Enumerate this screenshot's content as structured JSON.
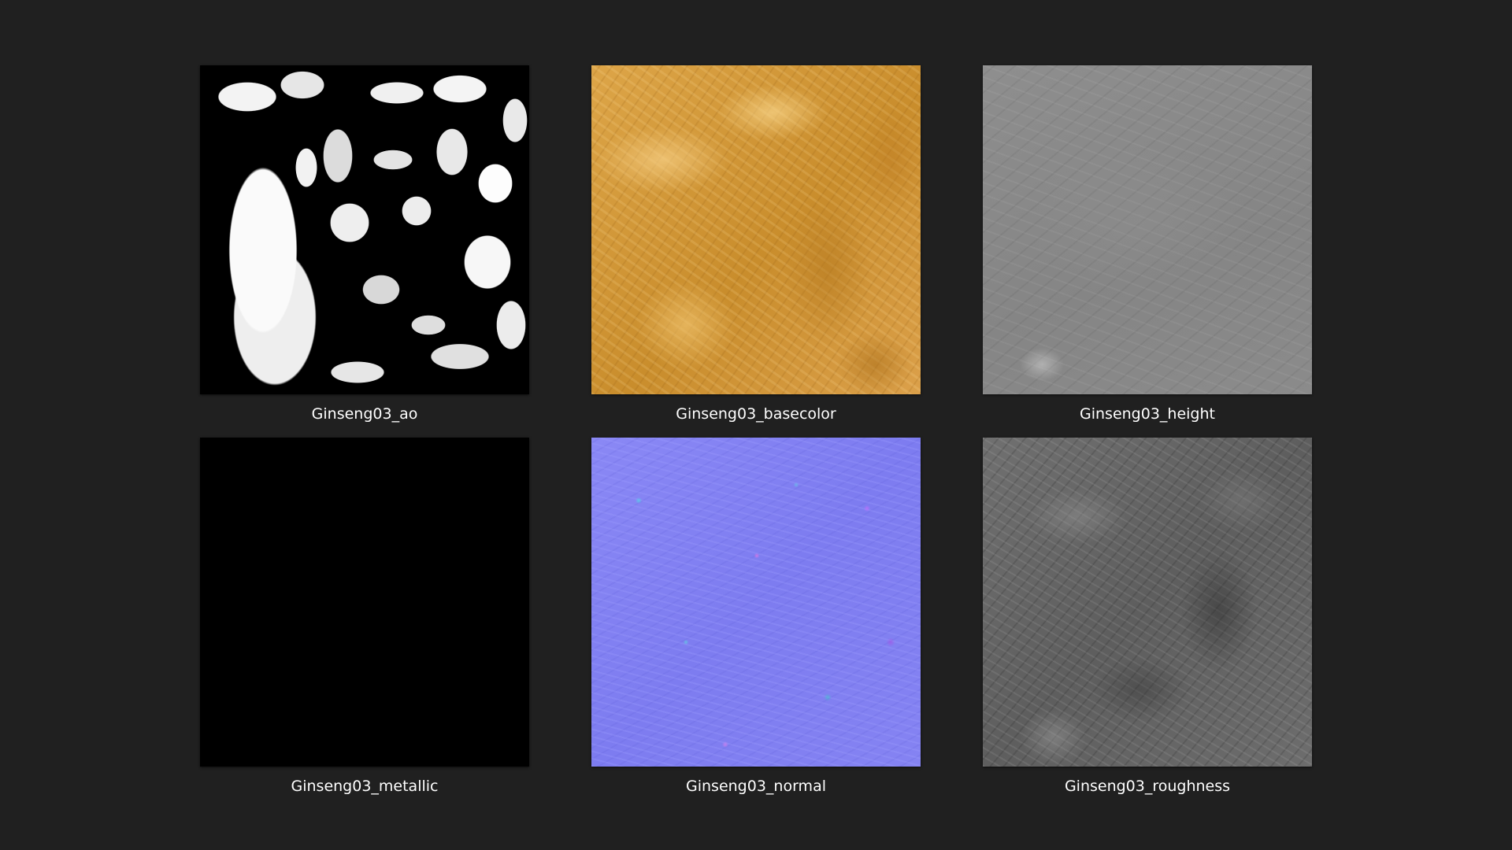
{
  "files": [
    {
      "name": "Ginseng03_ao",
      "map": "ambient-occlusion"
    },
    {
      "name": "Ginseng03_basecolor",
      "map": "base-color",
      "color": "#d9a548"
    },
    {
      "name": "Ginseng03_height",
      "map": "height",
      "color": "#8a8a8a"
    },
    {
      "name": "Ginseng03_metallic",
      "map": "metallic",
      "color": "#000000"
    },
    {
      "name": "Ginseng03_normal",
      "map": "normal",
      "color": "#8281f1"
    },
    {
      "name": "Ginseng03_roughness",
      "map": "roughness",
      "color": "#6c6c6c"
    }
  ],
  "theme": {
    "background": "#202020",
    "caption_color": "#ffffff"
  }
}
